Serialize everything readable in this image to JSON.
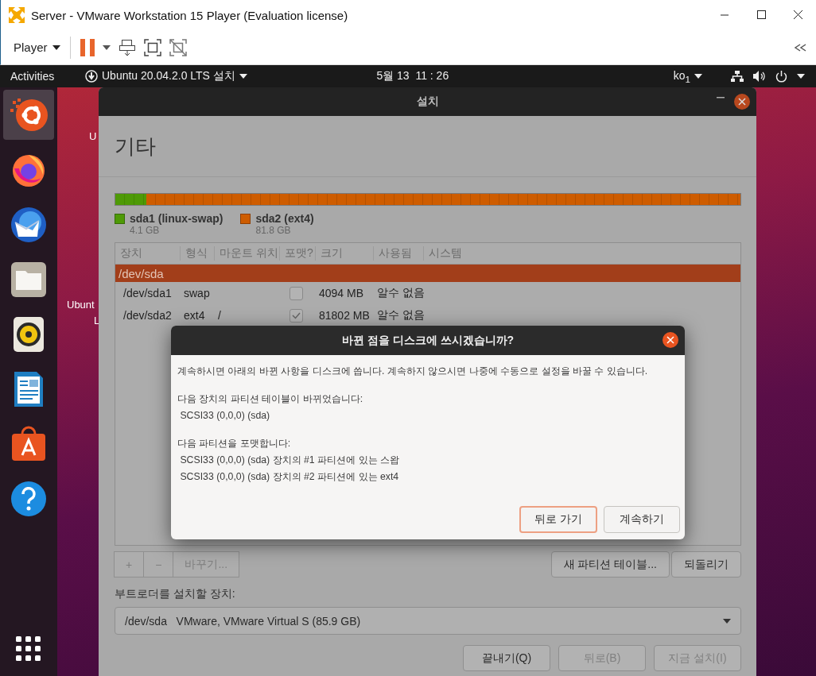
{
  "vmware": {
    "title": "Server - VMware Workstation 15 Player (Evaluation license)",
    "menu": "Player"
  },
  "topbar": {
    "activities": "Activities",
    "app_menu": "Ubuntu 20.04.2.0 LTS 설치",
    "clock": "5월 13  11 : 26",
    "input_source": "ko$_{1}$"
  },
  "dock": {
    "items": [
      {
        "kind": "ubuntu",
        "selected": true
      },
      {
        "kind": "firefox",
        "selected": false
      },
      {
        "kind": "mail",
        "selected": false
      },
      {
        "kind": "files",
        "selected": false
      },
      {
        "kind": "speaker",
        "selected": false
      },
      {
        "kind": "writer",
        "selected": false
      },
      {
        "kind": "software",
        "selected": false
      },
      {
        "kind": "help",
        "selected": false
      }
    ]
  },
  "desktop_icons": [
    {
      "lines": [
        "U"
      ]
    },
    {
      "lines": [
        "Ubunt",
        "L"
      ]
    }
  ],
  "installer": {
    "title": "설치",
    "heading": "기타",
    "partitions": [
      {
        "name": "sda1 (linux-swap)",
        "size": "4.1 GB",
        "color": "#4e9a06",
        "level": 0.05
      },
      {
        "name": "sda2 (ext4)",
        "size": "81.8 GB",
        "color": "#ce5c00",
        "level": 0.95
      }
    ],
    "table": {
      "columns": [
        "장치",
        "형식",
        "마운트 위치",
        "포맷?",
        "크기",
        "사용됨",
        "시스템"
      ],
      "rows": [
        {
          "kind": "disk",
          "device": "/dev/sda",
          "selected": true
        },
        {
          "kind": "partition",
          "device": "/dev/sda1",
          "type": "swap",
          "format": false,
          "size": "4094 MB",
          "used": "알수 없음",
          "selected": false
        },
        {
          "kind": "partition",
          "device": "/dev/sda2",
          "type": "ext4",
          "mount": "/",
          "format": true,
          "size": "81802 MB",
          "used": "알수 없음",
          "selected": false
        }
      ]
    },
    "tool_buttons": [
      {
        "label": "+",
        "disabled": true
      },
      {
        "label": "−",
        "disabled": true
      },
      {
        "label": "바꾸기...",
        "disabled": true
      }
    ],
    "table_buttons": [
      "새 파티션 테이블...",
      "되돌리기"
    ],
    "boot_label": "부트로더를 설치할 장치:",
    "boot_device": "/dev/sda   VMware, VMware Virtual S (85.9 GB)",
    "nav_buttons": [
      {
        "label": "끝내기(Q)",
        "disabled": false
      },
      {
        "label": "뒤로(B)",
        "disabled": true
      },
      {
        "label": "지금 설치(I)",
        "disabled": true
      }
    ]
  },
  "dialog": {
    "title": "바뀐 점을 디스크에 쓰시겠습니까?",
    "sections": [
      {
        "lines": [
          "계속하시면 아래의 바뀐 사항을 디스크에 씁니다. 계속하지 않으시면 나중에 수동으로 설정을 바꿀 수 있습니다."
        ]
      },
      {
        "lines": [
          "다음 장치의 파티션 테이블이 바뀌었습니다:",
          " SCSI33 (0,0,0) (sda)"
        ]
      },
      {
        "lines": [
          "다음 파티션을 포맷합니다:",
          " SCSI33 (0,0,0) (sda) 장치의 #1 파티션에 있는 스왑",
          " SCSI33 (0,0,0) (sda) 장치의 #2 파티션에 있는 ext4"
        ]
      }
    ],
    "buttons": [
      {
        "label": "뒤로 가기",
        "focused": true
      },
      {
        "label": "계속하기",
        "focused": false
      }
    ]
  }
}
